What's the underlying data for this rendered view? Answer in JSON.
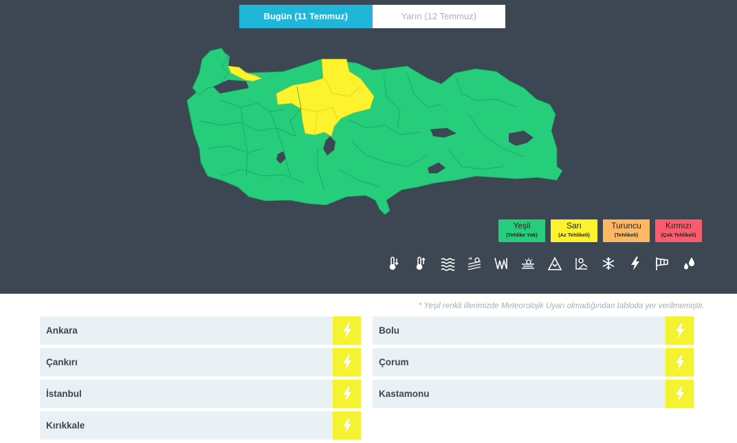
{
  "tabs": {
    "today": "Bugün (11 Temmuz)",
    "tomorrow": "Yarın (12 Temmuz)"
  },
  "colors": {
    "background": "#3d4754",
    "tab_active": "#1fb6d9",
    "green": "#26cd7b",
    "yellow": "#fdf22e",
    "orange": "#fdb864",
    "red": "#f85c6e"
  },
  "legend": [
    {
      "label": "Yeşil",
      "sub": "(Tehlike Yok)",
      "color": "#26cd7b"
    },
    {
      "label": "Sarı",
      "sub": "(Az Tehlikeli)",
      "color": "#fdf22e"
    },
    {
      "label": "Turuncu",
      "sub": "(Tehlikeli)",
      "color": "#fdb864"
    },
    {
      "label": "Kırmızı",
      "sub": "(Çok Tehlikeli)",
      "color": "#f85c6e"
    }
  ],
  "weather_icons": [
    "cold-thermometer-icon",
    "hot-thermometer-icon",
    "fog-waves-icon",
    "dust-sand-icon",
    "avalanche-lines-icon",
    "wind-fog-icon",
    "snow-mountain-icon",
    "storm-warning-icon",
    "snowflake-icon",
    "lightning-icon",
    "windsock-icon",
    "rain-drops-icon"
  ],
  "note": "* Yeşil renkli illerimizde Meteorolojik Uyarı olmadığından tabloda yer verilmemiştir.",
  "provinces_left": [
    "Ankara",
    "Çankırı",
    "İstanbul",
    "Kırıkkale"
  ],
  "provinces_right": [
    "Bolu",
    "Çorum",
    "Kastamonu"
  ]
}
